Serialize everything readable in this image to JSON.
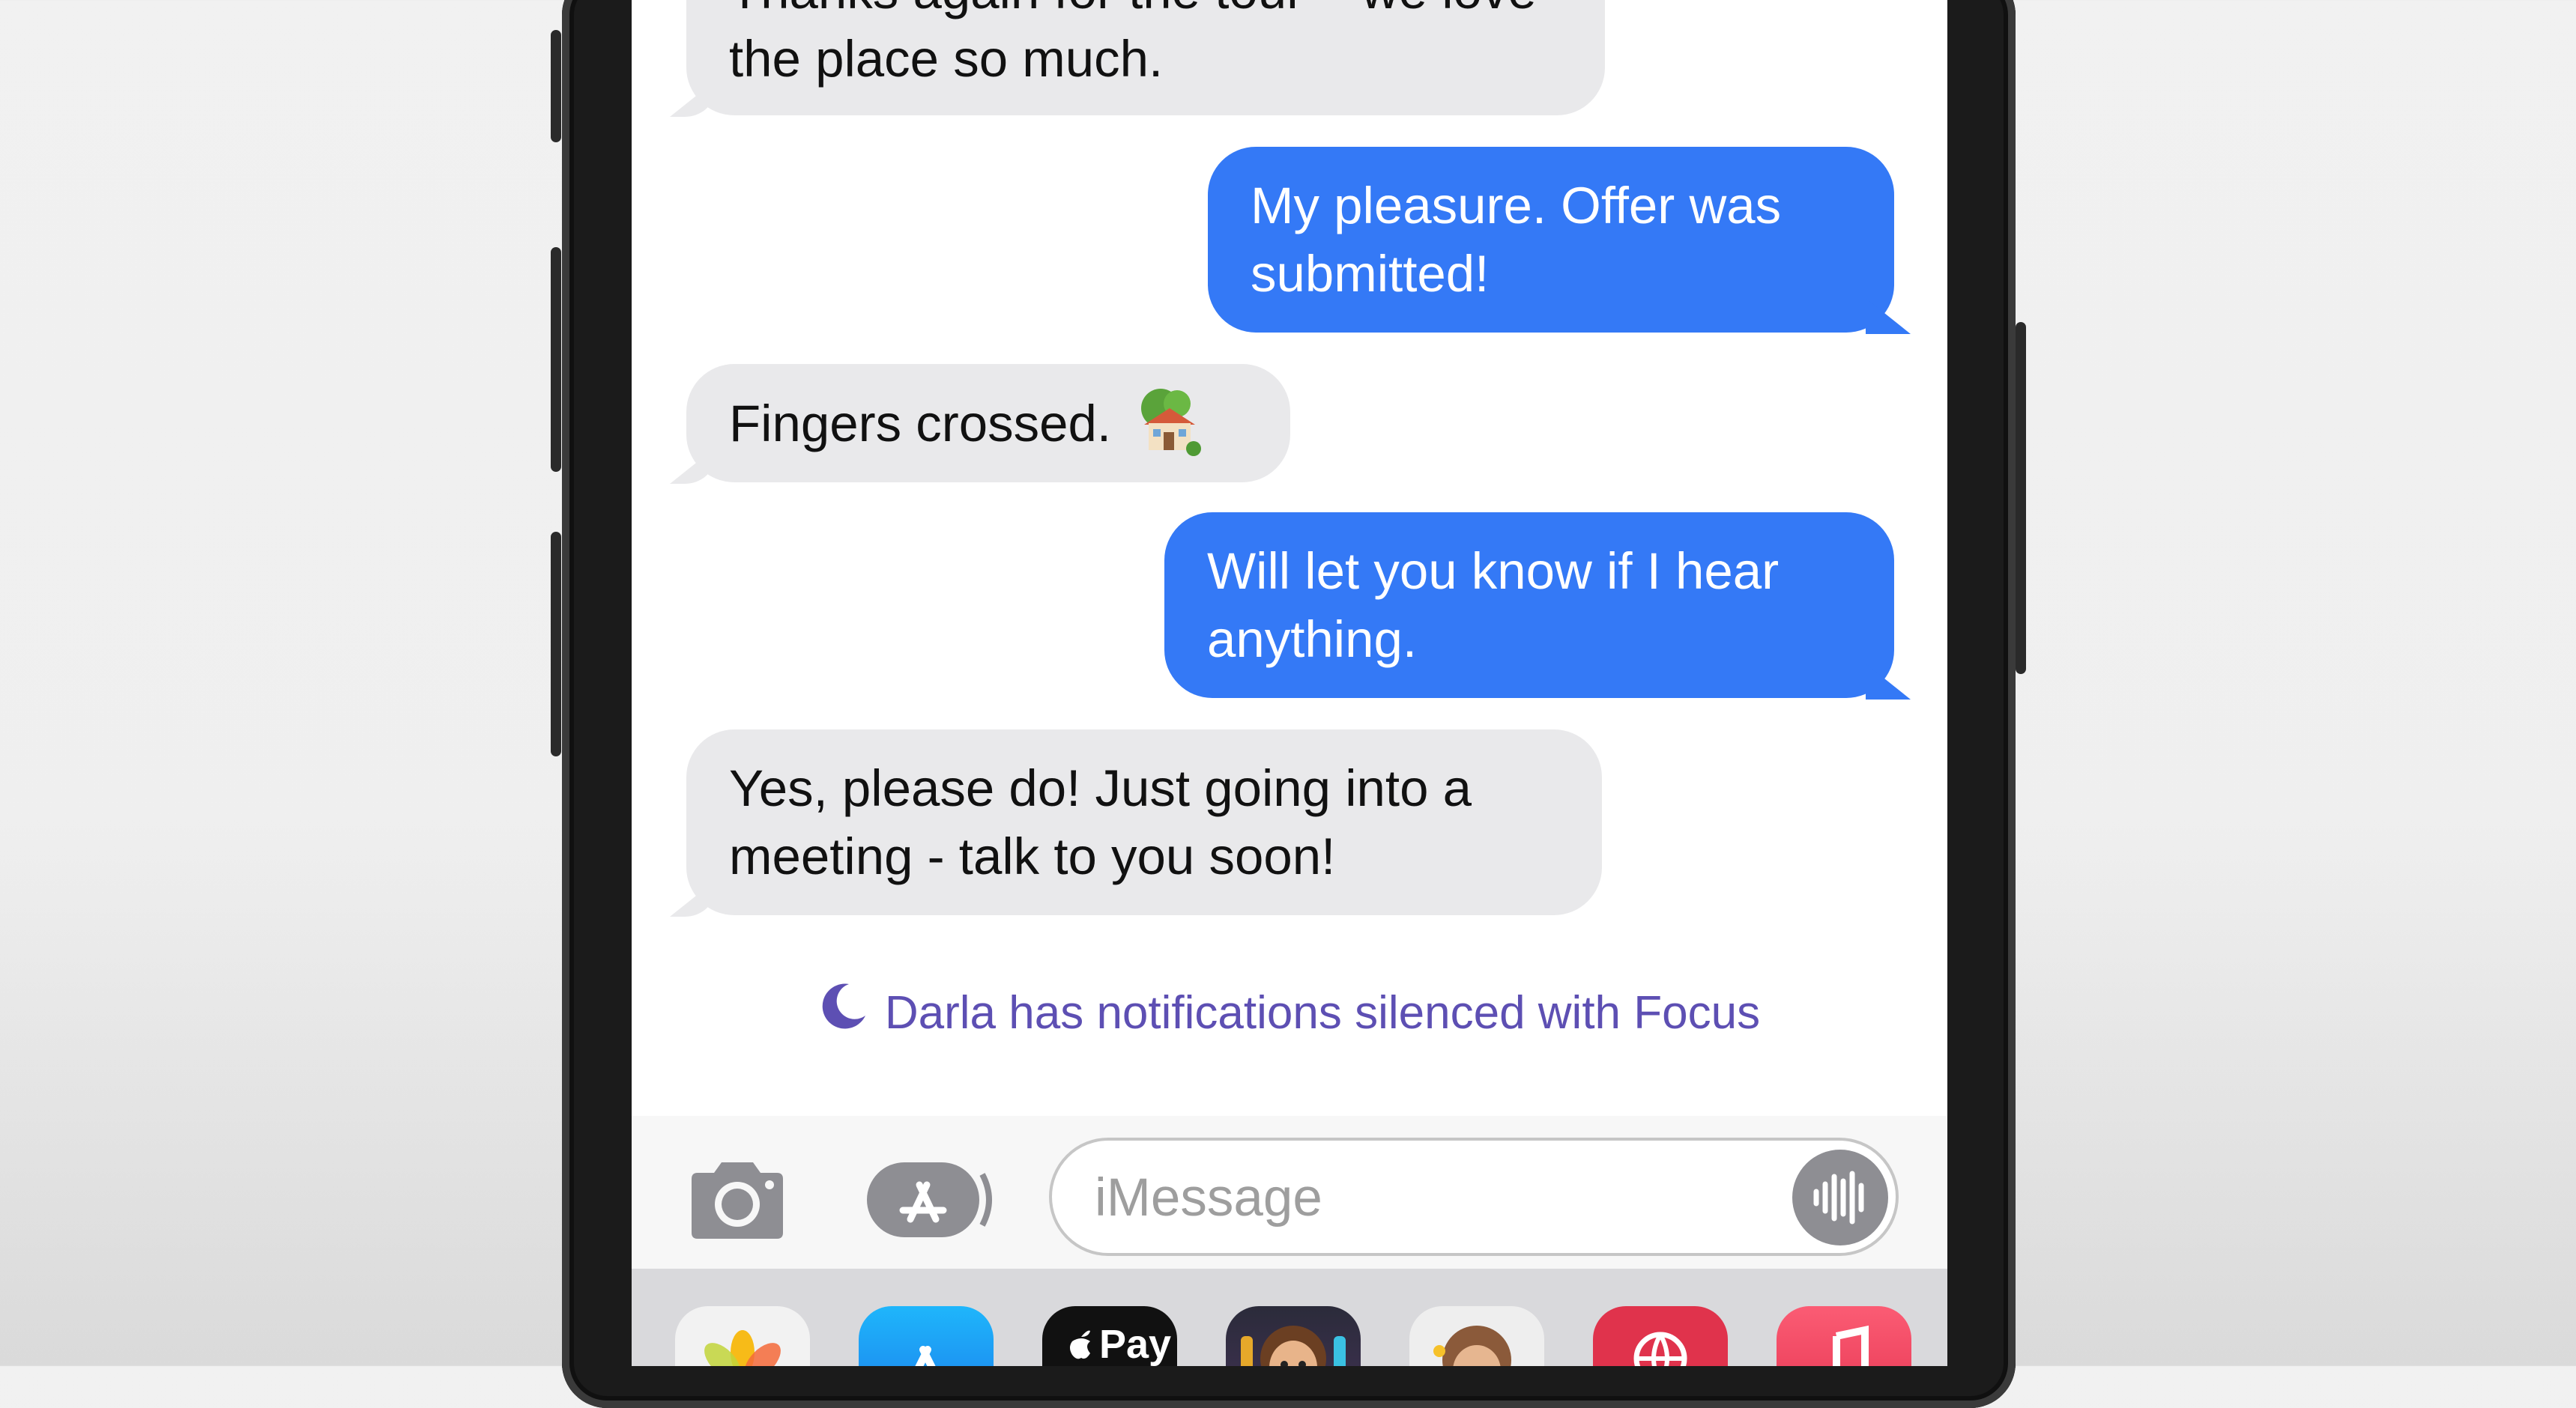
{
  "messages": [
    {
      "direction": "incoming",
      "text": "Thanks again for the tour – we love the place so much."
    },
    {
      "direction": "outgoing",
      "text": "My pleasure. Offer was submitted!"
    },
    {
      "direction": "incoming",
      "text": "Fingers crossed.",
      "emoji": "house-with-garden"
    },
    {
      "direction": "outgoing",
      "text": "Will let you know if I hear anything."
    },
    {
      "direction": "incoming",
      "text": "Yes, please do! Just going into a meeting - talk to you soon!"
    }
  ],
  "focus_notice": {
    "icon": "moon-icon",
    "text": "Darla has notifications silenced with Focus"
  },
  "compose": {
    "placeholder": "iMessage",
    "camera_icon": "camera-icon",
    "apps_icon": "app-store-icon",
    "dictation_icon": "waveform-icon"
  },
  "app_drawer": {
    "apps": [
      {
        "name": "photos-app-icon"
      },
      {
        "name": "app-store-app-icon"
      },
      {
        "name": "apple-pay-app-icon",
        "label": "Pay"
      },
      {
        "name": "memoji-app-icon"
      },
      {
        "name": "memoji-stickers-app-icon"
      },
      {
        "name": "web-search-app-icon"
      },
      {
        "name": "music-app-icon"
      }
    ]
  },
  "colors": {
    "incoming_bubble": "#e9e9eb",
    "outgoing_bubble": "#3479f6",
    "focus_text": "#5d4fb3"
  }
}
